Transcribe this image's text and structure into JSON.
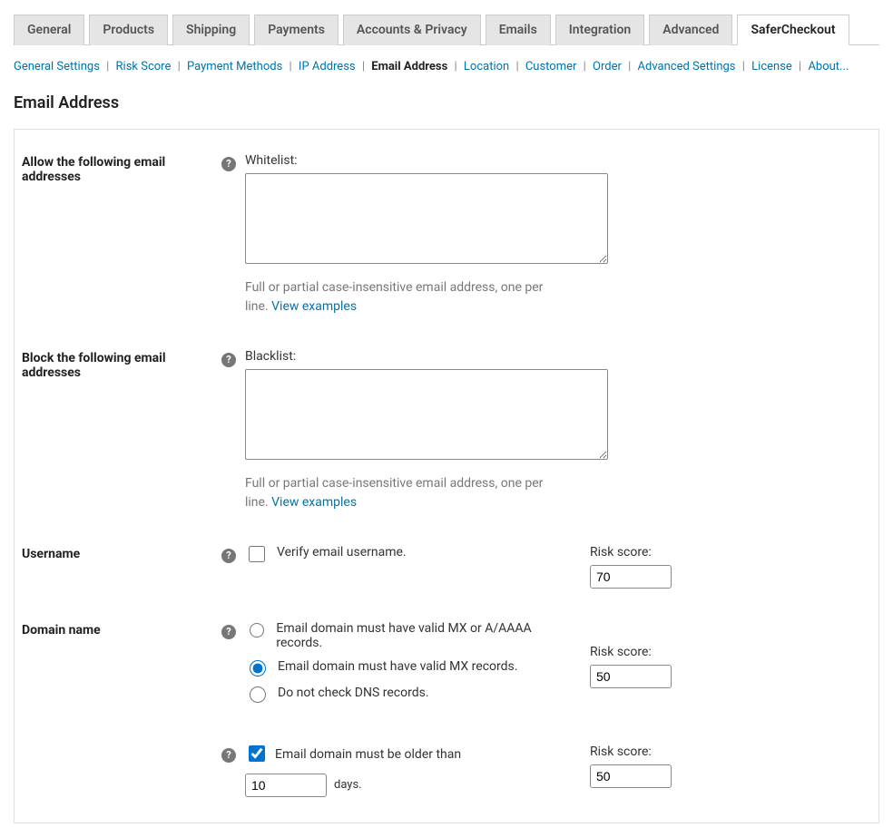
{
  "tabs": {
    "items": [
      "General",
      "Products",
      "Shipping",
      "Payments",
      "Accounts & Privacy",
      "Emails",
      "Integration",
      "Advanced",
      "SaferCheckout"
    ],
    "activeIndex": 8
  },
  "subnav": {
    "items": [
      "General Settings",
      "Risk Score",
      "Payment Methods",
      "IP Address",
      "Email Address",
      "Location",
      "Customer",
      "Order",
      "Advanced Settings",
      "License",
      "About..."
    ],
    "activeIndex": 4
  },
  "sectionTitle": "Email Address",
  "whitelist": {
    "rowLabel": "Allow the following email addresses",
    "fieldLabel": "Whitelist:",
    "value": "",
    "helper": "Full or partial case-insensitive email address, one per line. ",
    "helperLink": "View examples"
  },
  "blacklist": {
    "rowLabel": "Block the following email addresses",
    "fieldLabel": "Blacklist:",
    "value": "",
    "helper": "Full or partial case-insensitive email address, one per line. ",
    "helperLink": "View examples"
  },
  "username": {
    "rowLabel": "Username",
    "checkboxLabel": "Verify email username.",
    "checked": false,
    "riskLabel": "Risk score:",
    "riskValue": "70"
  },
  "domain": {
    "rowLabel": "Domain name",
    "options": {
      "opt1": "Email domain must have valid MX or A/AAAA records.",
      "opt2": "Email domain must have valid MX records.",
      "opt3": "Do not check DNS records."
    },
    "riskLabel": "Risk score:",
    "riskValue": "50",
    "ageCheckLabel": "Email domain must be older than",
    "ageDaysSuffix": "days.",
    "ageDaysValue": "10",
    "ageRiskLabel": "Risk score:",
    "ageRiskValue": "50"
  }
}
